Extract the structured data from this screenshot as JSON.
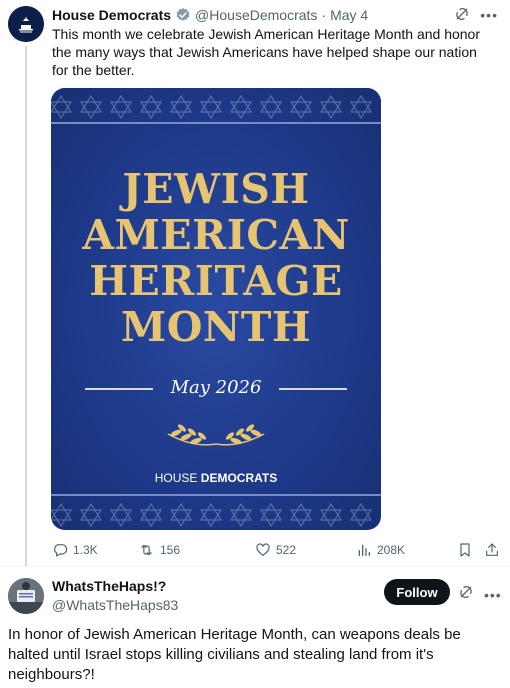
{
  "post1": {
    "author_name": "House Democrats",
    "handle": "@HouseDemocrats",
    "separator": "·",
    "date": "May 4",
    "text": "This month we celebrate Jewish American Heritage Month and honor the many ways that Jewish Americans have helped shape our nation for the better.",
    "more_icon": "ellipsis-icon",
    "grok_icon": "grok-icon",
    "verified_icon": "verified-badge-icon",
    "card": {
      "title": "JEWISH\nAMERICAN\nHERITAGE\nMONTH",
      "subtitle": "May 2026",
      "footer_left": "HOUSE ",
      "footer_right": "DEMOCRATS",
      "colors": {
        "background": "#1e3a8a",
        "title": "#e6c472",
        "laurel": "#e6c472"
      }
    },
    "actions": {
      "replies": "1.3K",
      "reposts": "156",
      "likes": "522",
      "views": "208K"
    }
  },
  "post2": {
    "author_name": "WhatsTheHaps!?",
    "handle": "@WhatsTheHaps83",
    "follow_label": "Follow",
    "text": "In honor of Jewish American Heritage Month, can weapons deals be halted until Israel stops killing civilians and stealing land from it's neighbours?!"
  },
  "colors": {
    "secondary_text": "#536471",
    "primary_text": "#0f1419",
    "verified": "#829aab"
  }
}
